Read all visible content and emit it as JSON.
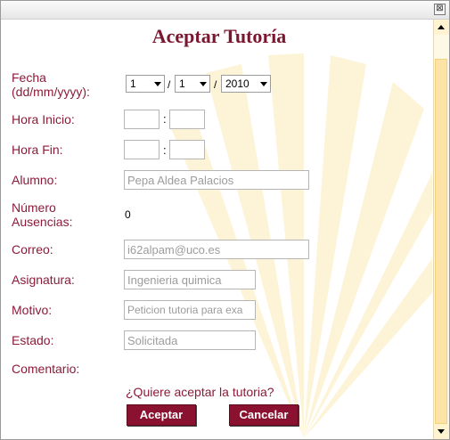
{
  "window": {
    "close_glyph": "⊠"
  },
  "dialog": {
    "title": "Aceptar Tutoría"
  },
  "form": {
    "fecha_label": "Fecha (dd/mm/yyyy):",
    "fecha": {
      "day": "1",
      "month": "1",
      "year": "2010",
      "separator": "/"
    },
    "hora_inicio_label": "Hora Inicio:",
    "hora_fin_label": "Hora Fin:",
    "time_separator": ":",
    "alumno_label": "Alumno:",
    "alumno_value": "Pepa Aldea Palacios",
    "ausencias_label": "Número Ausencias:",
    "ausencias_value": "0",
    "correo_label": "Correo:",
    "correo_value": "i62alpam@uco.es",
    "asignatura_label": "Asignatura:",
    "asignatura_value": "Ingenieria quimica",
    "motivo_label": "Motivo:",
    "motivo_value": "Peticion tutoria para exa",
    "estado_label": "Estado:",
    "estado_value": "Solicitada",
    "comentario_label": "Comentario:"
  },
  "prompt": {
    "question": "¿Quiere aceptar la tutoria?"
  },
  "buttons": {
    "accept": "Aceptar",
    "cancel": "Cancelar"
  },
  "colors": {
    "accent": "#8a1230",
    "label": "#8c1b3a",
    "scrollbar": "#fde3a6"
  }
}
